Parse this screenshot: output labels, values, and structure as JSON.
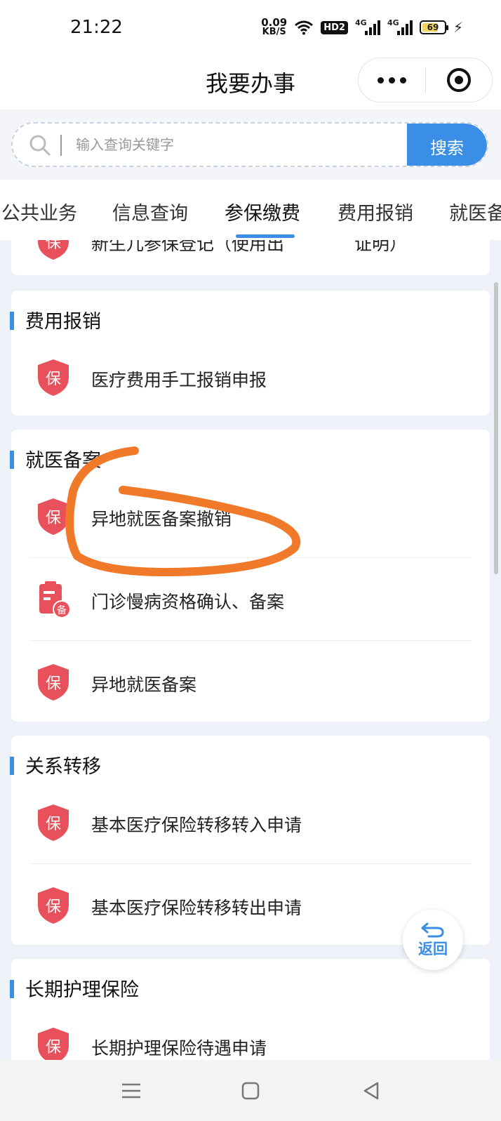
{
  "status_bar": {
    "time": "21:22",
    "net_speed_value": "0.09",
    "net_speed_unit": "KB/S",
    "hd_label": "HD2",
    "signal_label_1": "4G",
    "signal_label_2": "4G",
    "battery_level": "69"
  },
  "header": {
    "title": "我要办事"
  },
  "search": {
    "placeholder": "输入查询关键字",
    "button_label": "搜索"
  },
  "tabs": [
    {
      "label": "公共业务"
    },
    {
      "label": "信息查询"
    },
    {
      "label": "参保缴费",
      "active": true
    },
    {
      "label": "费用报销"
    },
    {
      "label": "就医备"
    }
  ],
  "partial_item": {
    "label": "新生儿参保登记（使用出　　　　证明）"
  },
  "sections": [
    {
      "title": "费用报销",
      "items": [
        {
          "label": "医疗费用手工报销申报",
          "icon": "shield-icon"
        }
      ]
    },
    {
      "title": "就医备案",
      "items": [
        {
          "label": "异地就医备案撤销",
          "icon": "shield-icon"
        },
        {
          "label": "门诊慢病资格确认、备案",
          "icon": "clipboard-icon",
          "badge": "备"
        },
        {
          "label": "异地就医备案",
          "icon": "shield-icon"
        }
      ]
    },
    {
      "title": "关系转移",
      "items": [
        {
          "label": "基本医疗保险转移转入申请",
          "icon": "shield-icon"
        },
        {
          "label": "基本医疗保险转移转出申请",
          "icon": "shield-icon"
        }
      ]
    },
    {
      "title": "长期护理保险",
      "items": [
        {
          "label": "长期护理保险待遇申请",
          "icon": "shield-icon"
        }
      ]
    }
  ],
  "shield_glyph": "保",
  "back_button": {
    "label": "返回"
  },
  "colors": {
    "accent": "#3a8ee6",
    "shield": "#e8505b",
    "annotation": "#f07a2a"
  }
}
